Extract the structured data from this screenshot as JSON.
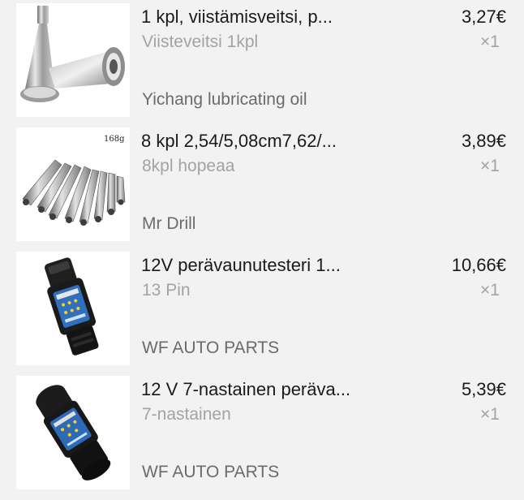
{
  "items": [
    {
      "title": "1 kpl, viistämisveitsi, p...",
      "variant": "Viisteveitsi 1kpl",
      "store": "Yichang lubricating oil",
      "price": "3,27€",
      "qty": "×1",
      "image_icon": "chamfer-tool-image"
    },
    {
      "title": "8 kpl 2,54/5,08cm7,62/...",
      "variant": "8kpl hopeaa",
      "store": "Mr Drill",
      "price": "3,89€",
      "qty": "×1",
      "image_icon": "socket-adapter-set-image",
      "image_label": "168g"
    },
    {
      "title": "12V perävaunutesteri 1...",
      "variant": "13 Pin",
      "store": "WF AUTO PARTS",
      "price": "10,66€",
      "qty": "×1",
      "image_icon": "trailer-tester-image"
    },
    {
      "title": "12 V 7-nastainen peräva...",
      "variant": "7-nastainen",
      "store": "WF AUTO PARTS",
      "price": "5,39€",
      "qty": "×1",
      "image_icon": "trailer-tester-image"
    }
  ]
}
